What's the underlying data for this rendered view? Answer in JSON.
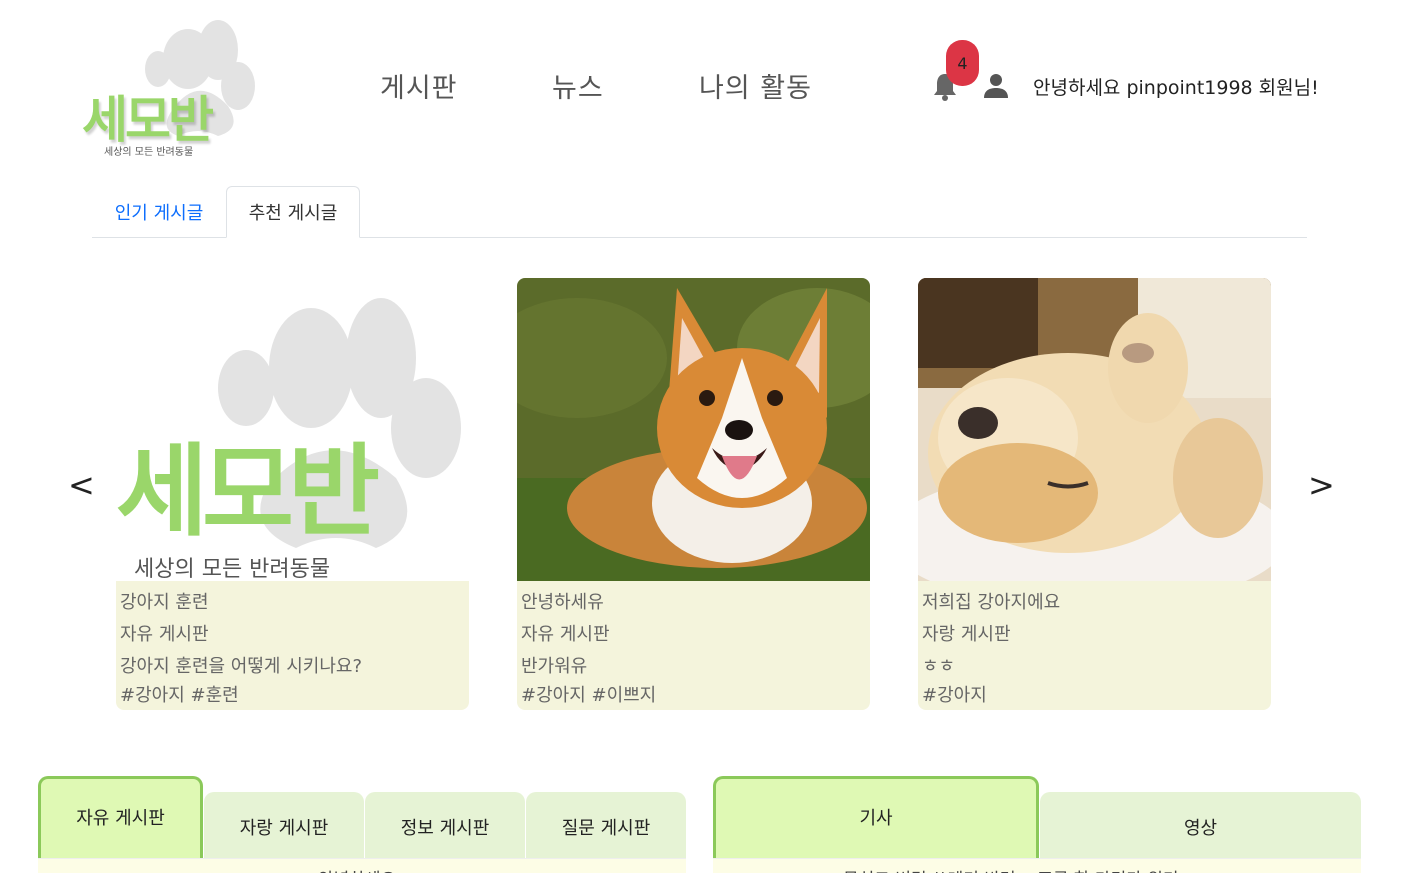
{
  "brand": {
    "name": "세모반",
    "tagline": "세상의 모든 반려동물",
    "accent": "#9ad66a"
  },
  "nav": {
    "items": [
      "게시판",
      "뉴스",
      "나의 활동"
    ]
  },
  "header": {
    "notification_count": "4",
    "greeting": "안녕하세요 pinpoint1998 회원님!"
  },
  "post_tabs": {
    "popular": "인기 게시글",
    "recommended": "추천 게시글"
  },
  "carousel": {
    "prev": "<",
    "next": ">",
    "cards": [
      {
        "title": "강아지 훈련",
        "board": "자유 게시판",
        "content": "강아지 훈련을 어떻게 시키나요?",
        "tags": "#강아지 #훈련",
        "image": "logo-placeholder"
      },
      {
        "title": "안녕하세유",
        "board": "자유 게시판",
        "content": "반가워유",
        "tags": "#강아지 #이쁘지",
        "image": "corgi-photo"
      },
      {
        "title": "저희집 강아지에요",
        "board": "자랑 게시판",
        "content": "ㅎㅎ",
        "tags": "#강아지",
        "image": "sleeping-dog-photo"
      }
    ]
  },
  "boards": {
    "tabs": [
      "자유 게시판",
      "자랑 게시판",
      "정보 게시판",
      "질문 게시판"
    ],
    "first_row": "안녕하세요"
  },
  "news": {
    "tabs": [
      "기사",
      "영상"
    ],
    "first_row": "무심코 버린 쓰레기 반려... 조류 한 마리가 위기"
  },
  "colors": {
    "selected_tab": "#dff9b4",
    "unselected_tab": "#e6f3d5",
    "badge": "#dc3545",
    "link": "#0d6efd"
  }
}
